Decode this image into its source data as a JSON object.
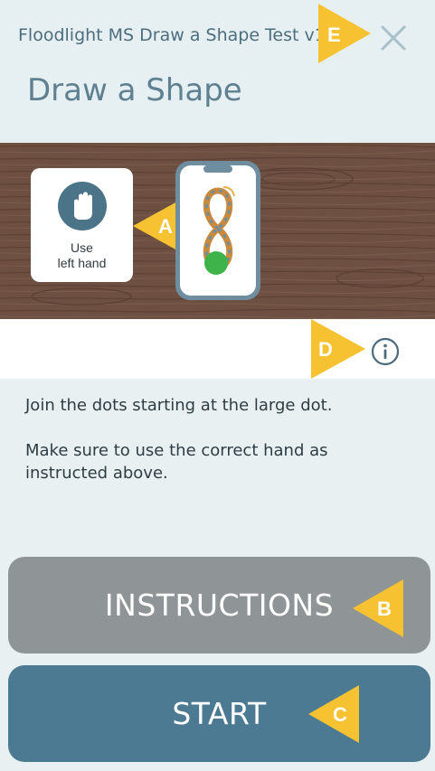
{
  "header": {
    "app_title": "Floodlight MS Draw a Shape Test v1.2",
    "page_title": "Draw a Shape",
    "close_icon": "close-icon"
  },
  "banner": {
    "hand_icon": "hand-icon",
    "hand_label_line1": "Use",
    "hand_label_line2": "left hand",
    "shape_icon": "figure-eight-shape-icon"
  },
  "markers": {
    "a": "A",
    "b": "B",
    "c": "C",
    "d": "D",
    "e": "E"
  },
  "info": {
    "icon": "info-icon"
  },
  "description": {
    "line1": "Join the dots starting at the large dot.",
    "line2": "Make sure to use the correct hand as instructed above."
  },
  "buttons": {
    "instructions_label": "INSTRUCTIONS",
    "start_label": "START"
  },
  "colors": {
    "marker_yellow": "#f7c232",
    "start_blue": "#4c7a92",
    "instructions_gray": "#8f9597",
    "title_blue": "#5f8090",
    "wood_brown": "#6b4d3f"
  }
}
